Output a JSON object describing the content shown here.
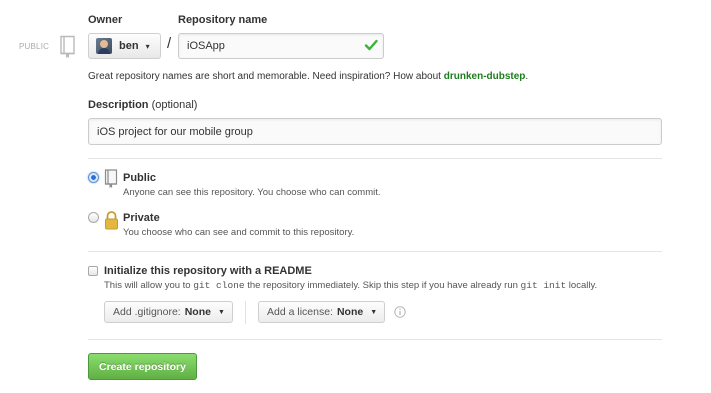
{
  "labels": {
    "owner": "Owner",
    "repo_name": "Repository name",
    "description": "Description",
    "optional": "(optional)"
  },
  "side_visibility_label": "PUBLIC",
  "owner": {
    "name": "ben"
  },
  "repo_name": {
    "value": "iOSApp"
  },
  "name_hint": {
    "prefix": "Great repository names are short and memorable. Need inspiration? How about",
    "suggestion": "drunken-dubstep",
    "suffix": "."
  },
  "description": {
    "value": "iOS project for our mobile group"
  },
  "visibility": {
    "selected": "public",
    "options": [
      {
        "title": "Public",
        "desc": "Anyone can see this repository. You choose who can commit."
      },
      {
        "title": "Private",
        "desc": "You choose who can see and commit to this repository."
      }
    ]
  },
  "init": {
    "label": "Initialize this repository with a README",
    "desc_a": "This will allow you to",
    "code_a": "git clone",
    "desc_b": "the repository immediately. Skip this step if you have already run",
    "code_b": "git init",
    "desc_c": "locally.",
    "checked": false
  },
  "gitignore": {
    "label": "Add .gitignore:",
    "value": "None"
  },
  "license": {
    "label": "Add a license:",
    "value": "None"
  },
  "submit": {
    "label": "Create repository"
  },
  "colors": {
    "accent_green": "#60b044",
    "suggestion_green": "#1e7d1e",
    "check_green": "#3cb13c",
    "radio_blue": "#2b6ed1",
    "lock_gold": "#e3b83e"
  },
  "icons": {
    "repo": "repo-icon",
    "check": "check-icon",
    "lock": "lock-icon",
    "info": "info-icon",
    "caret": "chevron-down-icon"
  }
}
